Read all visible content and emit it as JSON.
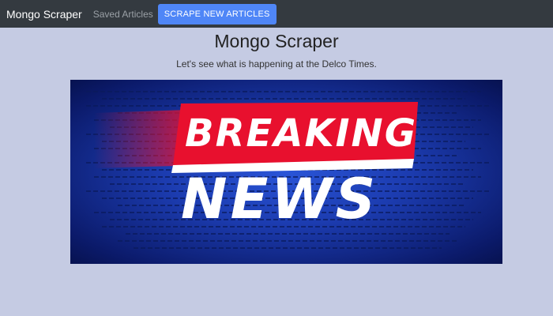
{
  "navbar": {
    "brand": "Mongo Scraper",
    "saved_link": "Saved Articles",
    "scrape_button": "SCRAPE NEW ARTICLES"
  },
  "main": {
    "title": "Mongo Scraper",
    "subtitle": "Let's see what is happening at the Delco Times.",
    "banner": {
      "line1": "BREAKING",
      "line2": "NEWS"
    }
  },
  "colors": {
    "navbar_bg": "#343a40",
    "page_bg": "#c5cbe3",
    "button_bg": "#4f86f7",
    "banner_red": "#e8102e",
    "banner_blue": "#1c3cb0"
  }
}
